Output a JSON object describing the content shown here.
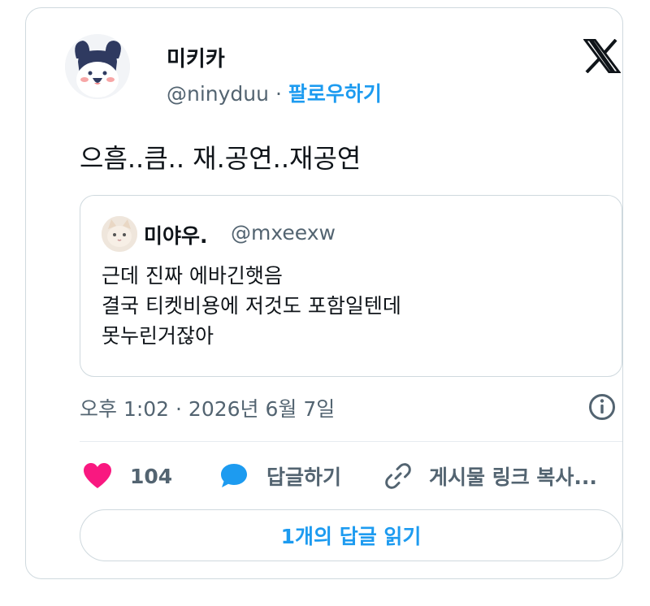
{
  "author": {
    "display_name": "미키카",
    "handle": "@ninyduu",
    "separator": "·",
    "follow_label": "팔로우하기"
  },
  "tweet": {
    "text": "으흠..큼.. 재.공연..재공연",
    "timestamp": "오후 1:02 · 2026년 6월 7일"
  },
  "quote": {
    "display_name": "미야우.",
    "handle": "@mxeexw",
    "lines": [
      "근데 진짜 에바긴햇음",
      "결국 티켓비용에 저것도 포함일텐데",
      "못누린거잖아"
    ]
  },
  "actions": {
    "like_count": "104",
    "reply_label": "답글하기",
    "copy_link_label": "게시물 링크 복사..."
  },
  "read_replies_label": "1개의 답글 읽기",
  "colors": {
    "accent": "#1d9bf0",
    "like": "#f91880",
    "secondary_text": "#536471",
    "border": "#cfd9de"
  },
  "icons": [
    "x-logo-icon",
    "info-icon",
    "heart-icon",
    "speech-bubble-icon",
    "link-icon"
  ]
}
